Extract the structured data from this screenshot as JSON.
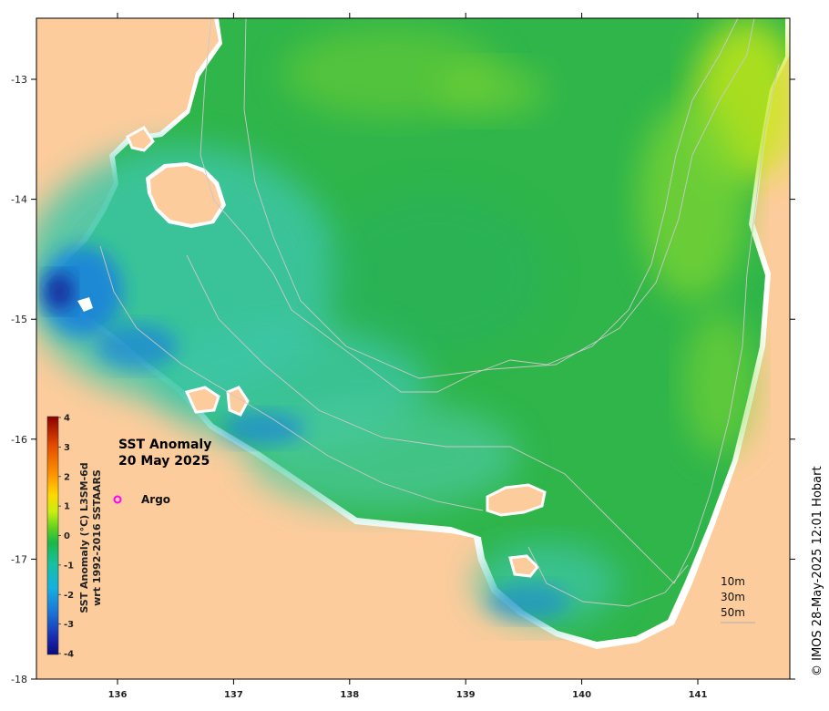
{
  "title": {
    "line1": "SST Anomaly",
    "line2": "20 May 2025"
  },
  "argo_label": "Argo",
  "colorbar": {
    "title_line1": "SST Anomaly (°C) L3SM-6d",
    "title_line2": "wrt 1992-2016 SSTAARS",
    "ticks": [
      "4",
      "3",
      "2",
      "1",
      "0",
      "-1",
      "-2",
      "-3",
      "-4"
    ],
    "colors": [
      "#8b0000",
      "#e34a00",
      "#ff9900",
      "#ffd800",
      "#e8f000",
      "#8fe000",
      "#22c028",
      "#1aa85a",
      "#19c0a0",
      "#19c8d0",
      "#16a8e0",
      "#1a78d8",
      "#1a3ec0",
      "#0b0a7a"
    ]
  },
  "axes": {
    "x_ticks": [
      "136",
      "137",
      "138",
      "139",
      "140",
      "141"
    ],
    "y_ticks": [
      "-13",
      "-14",
      "-15",
      "-16",
      "-17",
      "-18"
    ]
  },
  "depth_legend": [
    "10m",
    "30m",
    "50m"
  ],
  "credit": "© IMOS 28-May-2025 12:01 Hobart",
  "colors": {
    "land": "#fdcc9c",
    "ocean_main": "#2fb54a",
    "ocean_cool": "#3cc6a6",
    "ocean_cold": "#1f86d8",
    "ocean_coldest": "#13289a",
    "ocean_warm": "#7ed630",
    "ocean_warmest": "#c8e818",
    "contour": "#c8c8c8"
  }
}
